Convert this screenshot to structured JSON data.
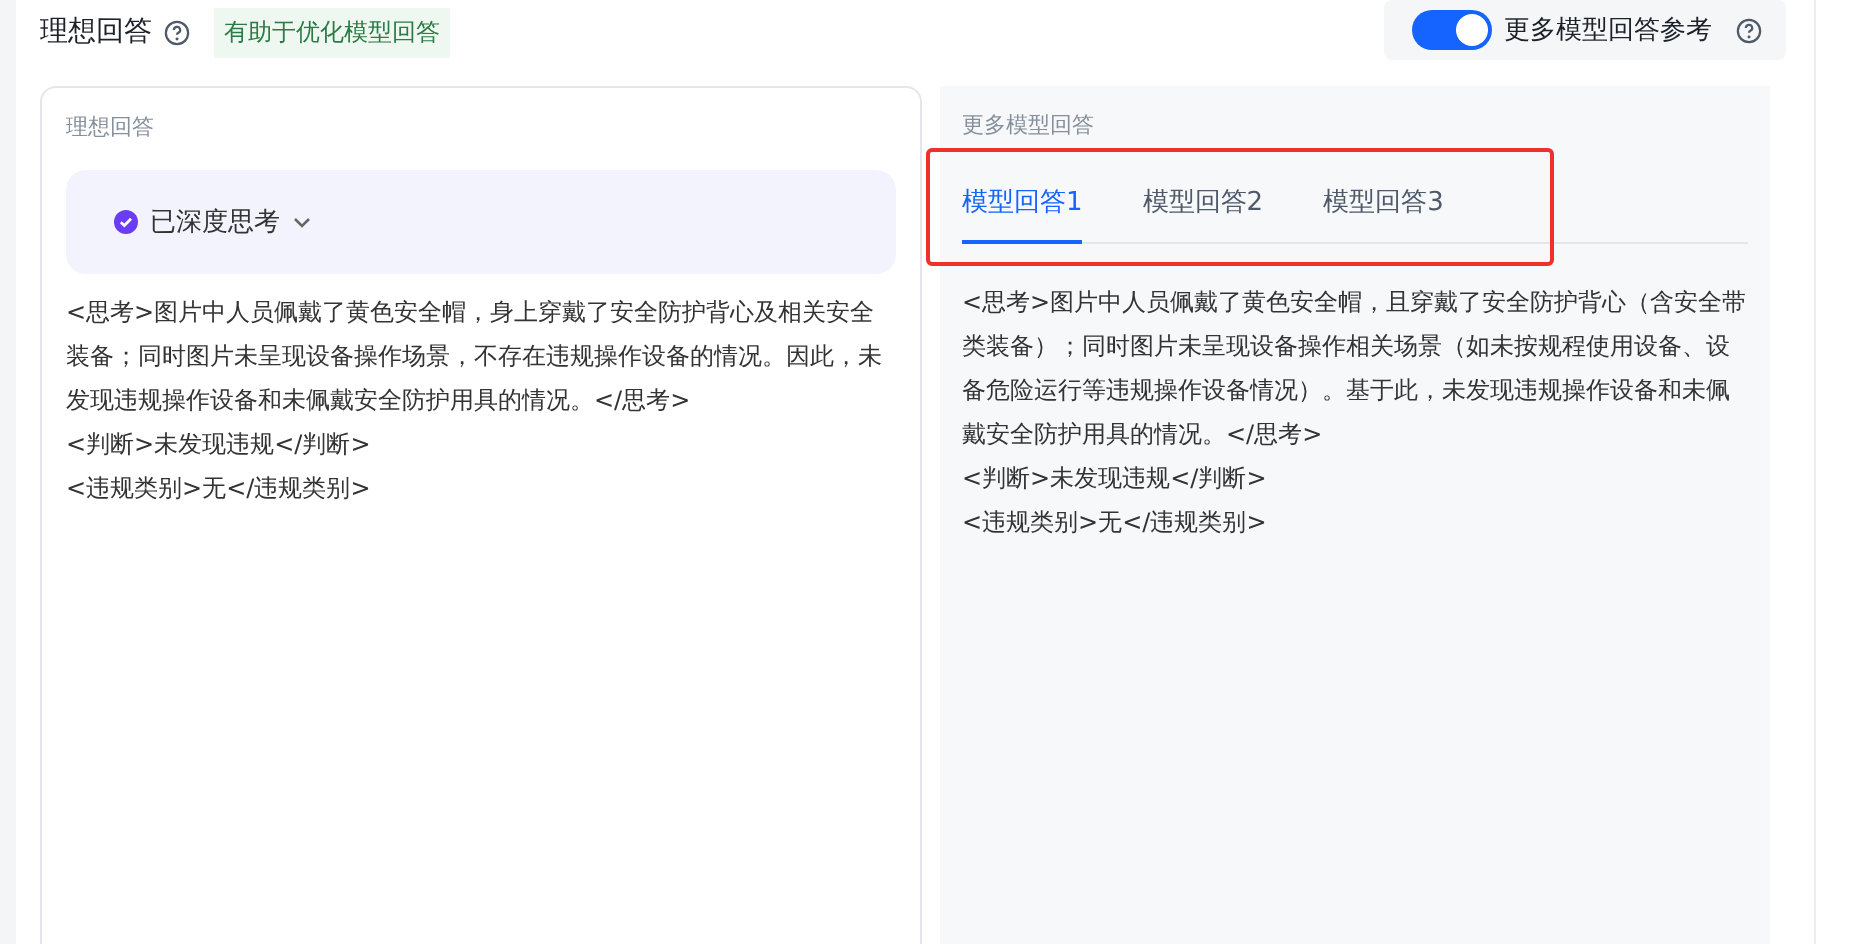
{
  "header": {
    "title": "理想回答",
    "hint_tag": "有助于优化模型回答",
    "toggle": {
      "label": "更多模型回答参考",
      "on": true
    }
  },
  "ideal": {
    "label": "理想回答",
    "thinking": {
      "label": "已深度思考",
      "expanded": false
    },
    "lines": [
      "<思考>图片中人员佩戴了黄色安全帽，身上穿戴了安全防护背心及相关安全装备；同时图片未呈现设备操作场景，不存在违规操作设备的情况。因此，未发现违规操作设备和未佩戴安全防护用具的情况。</思考>",
      "<判断>未发现违规</判断>",
      "<违规类别>无</违规类别>"
    ]
  },
  "more": {
    "label": "更多模型回答",
    "tabs": [
      {
        "label": "模型回答1",
        "selected": true
      },
      {
        "label": "模型回答2",
        "selected": false
      },
      {
        "label": "模型回答3",
        "selected": false
      }
    ],
    "lines": [
      "<思考>图片中人员佩戴了黄色安全帽，且穿戴了安全防护背心（含安全带类装备）；同时图片未呈现设备操作相关场景（如未按规程使用设备、设备危险运行等违规操作设备情况）。基于此，未发现违规操作设备和未佩戴安全防护用具的情况。</思考>",
      "<判断>未发现违规</判断>",
      "<违规类别>无</违规类别>"
    ]
  }
}
